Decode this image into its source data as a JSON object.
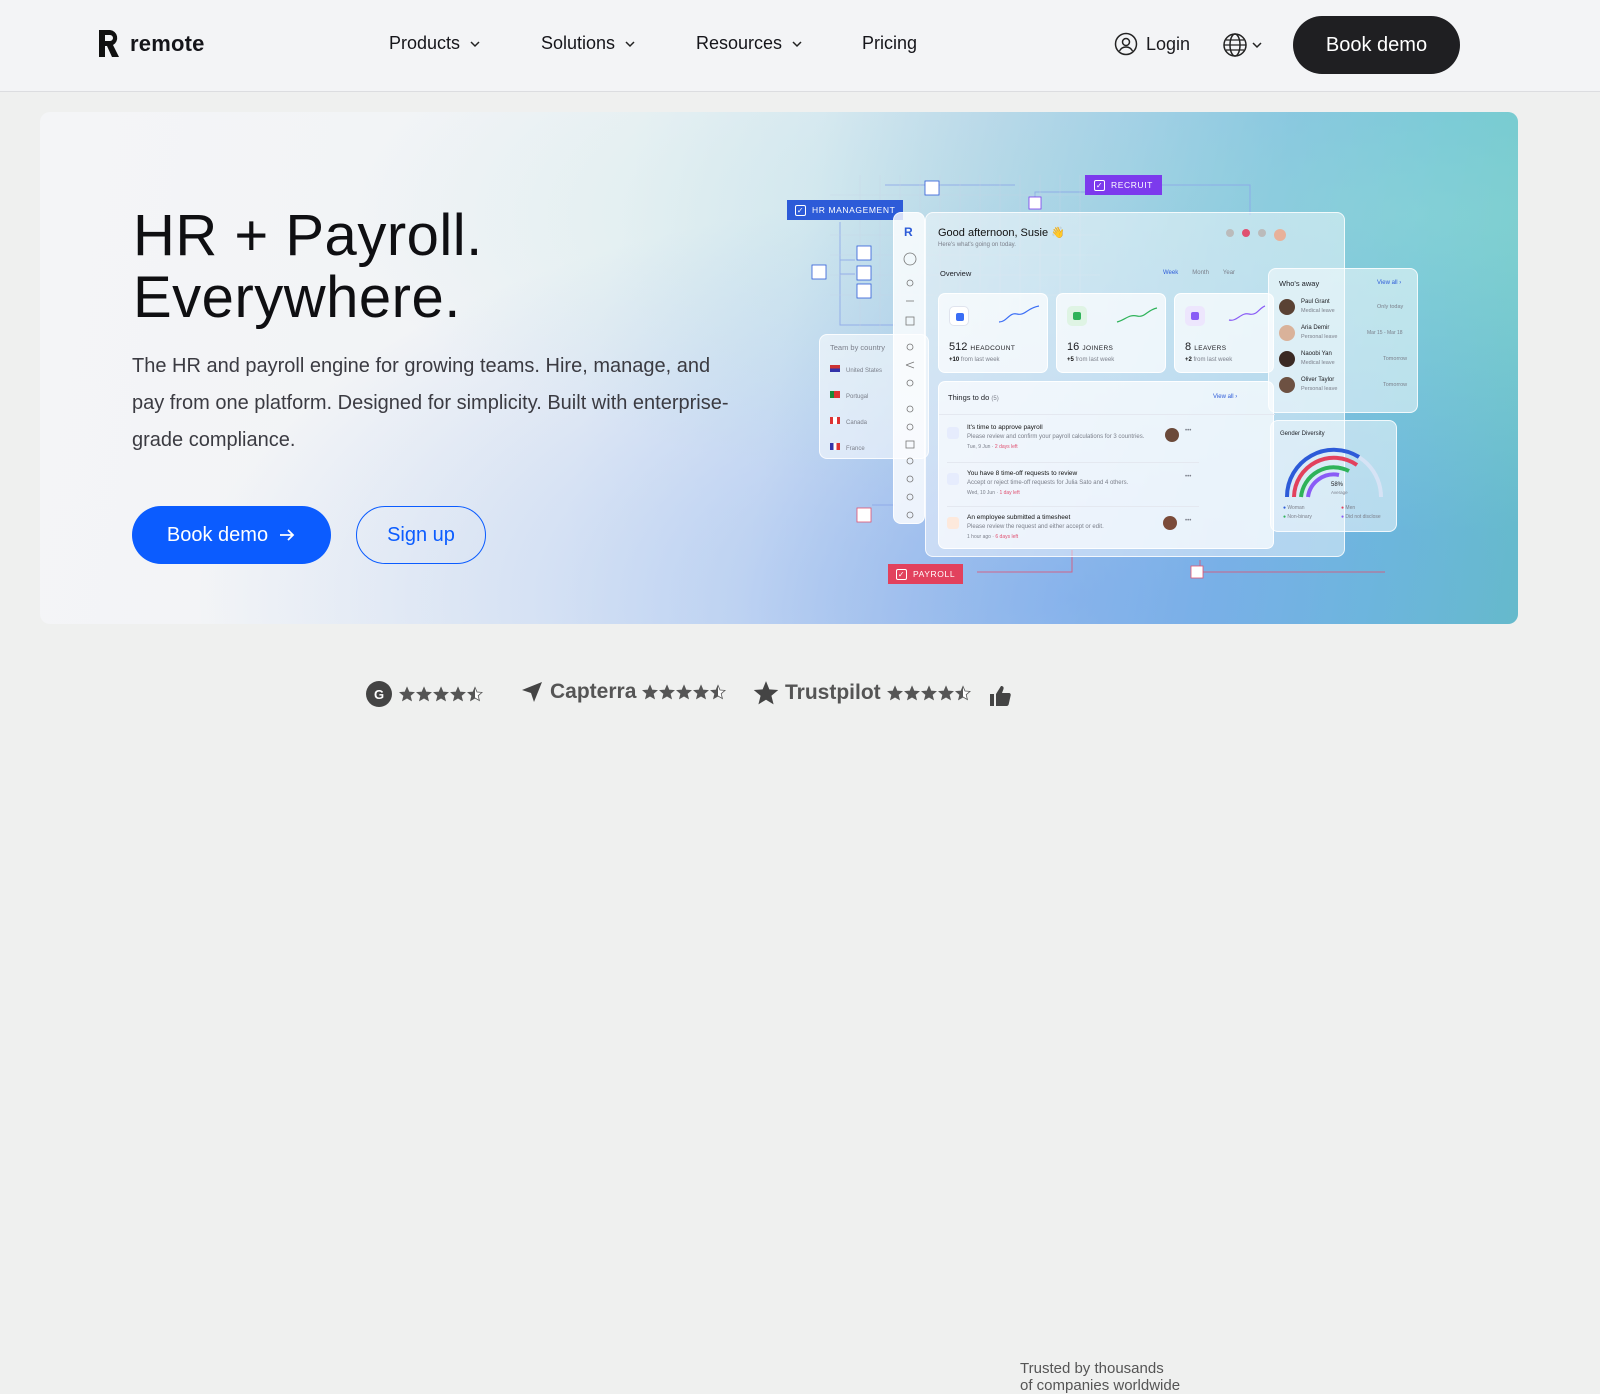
{
  "nav": {
    "brand": "remote",
    "menu": [
      "Products",
      "Solutions",
      "Resources",
      "Pricing"
    ],
    "login": "Login",
    "cta": "Book demo"
  },
  "hero": {
    "title_line1": "HR + Payroll.",
    "title_line2": "Everywhere.",
    "subtitle": "The HR and payroll engine for growing teams. Hire, manage, and pay from one platform. Designed for simplicity. Built with enterprise-grade compliance.",
    "primary_cta": "Book demo",
    "secondary_cta": "Sign up"
  },
  "dashboard": {
    "tags": {
      "hr": "HR MANAGEMENT",
      "recruit": "RECRUIT",
      "payroll": "PAYROLL"
    },
    "greeting": "Good afternoon, Susie 👋",
    "greeting_sub": "Here's what's going on today.",
    "overview": "Overview",
    "periods": [
      "Week",
      "Month",
      "Year"
    ],
    "stats": [
      {
        "value": "512",
        "label": "HEADCOUNT",
        "delta": "+10",
        "note": "from last week",
        "color": "#3b6ef5"
      },
      {
        "value": "16",
        "label": "JOINERS",
        "delta": "+5",
        "note": "from last week",
        "color": "#2fb35a"
      },
      {
        "value": "8",
        "label": "LEAVERS",
        "delta": "+2",
        "note": "from last week",
        "color": "#8a5cf6"
      }
    ],
    "todo_title": "Things to do",
    "todo_count": "(5)",
    "view_all": "View all",
    "todos": [
      {
        "title": "It's time to approve payroll",
        "desc": "Please review and confirm your payroll calculations for 3 countries.",
        "date": "Tue, 9 Jun",
        "due": "2 days left"
      },
      {
        "title": "You have 8 time-off requests to review",
        "desc": "Accept or reject time-off requests for Julia Sato and 4 others.",
        "date": "Wed, 10 Jun",
        "due": "1 day left"
      },
      {
        "title": "An employee submitted a timesheet",
        "desc": "Please review the request and either accept or edit.",
        "date": "1 hour ago",
        "due": "6 days left"
      }
    ],
    "team_title": "Team by country",
    "countries": [
      "United States",
      "Portugal",
      "Canada",
      "France"
    ],
    "away_title": "Who's away",
    "away": [
      {
        "name": "Paul Grant",
        "type": "Medical leave",
        "when": "Only today"
      },
      {
        "name": "Aria Demir",
        "type": "Personal leave",
        "when": "Mar 15 - Mar 18"
      },
      {
        "name": "Naoobi Yan",
        "type": "Medical leave",
        "when": "Tomorrow"
      },
      {
        "name": "Oliver Taylor",
        "type": "Personal leave",
        "when": "Tomorrow"
      }
    ],
    "gender_title": "Gender Diversity",
    "gender_pct": "58%",
    "gender_sub": "Average",
    "gender_legend": [
      "Woman",
      "Men",
      "Non-binary",
      "Did not disclose"
    ]
  },
  "reviews": {
    "g2_rating": 4.5,
    "capterra": "Capterra",
    "capterra_rating": 4.5,
    "trustpilot": "Trustpilot",
    "trustpilot_rating": 4.5,
    "trusted_line1": "Trusted by thousands",
    "trusted_line2": "of companies worldwide"
  }
}
